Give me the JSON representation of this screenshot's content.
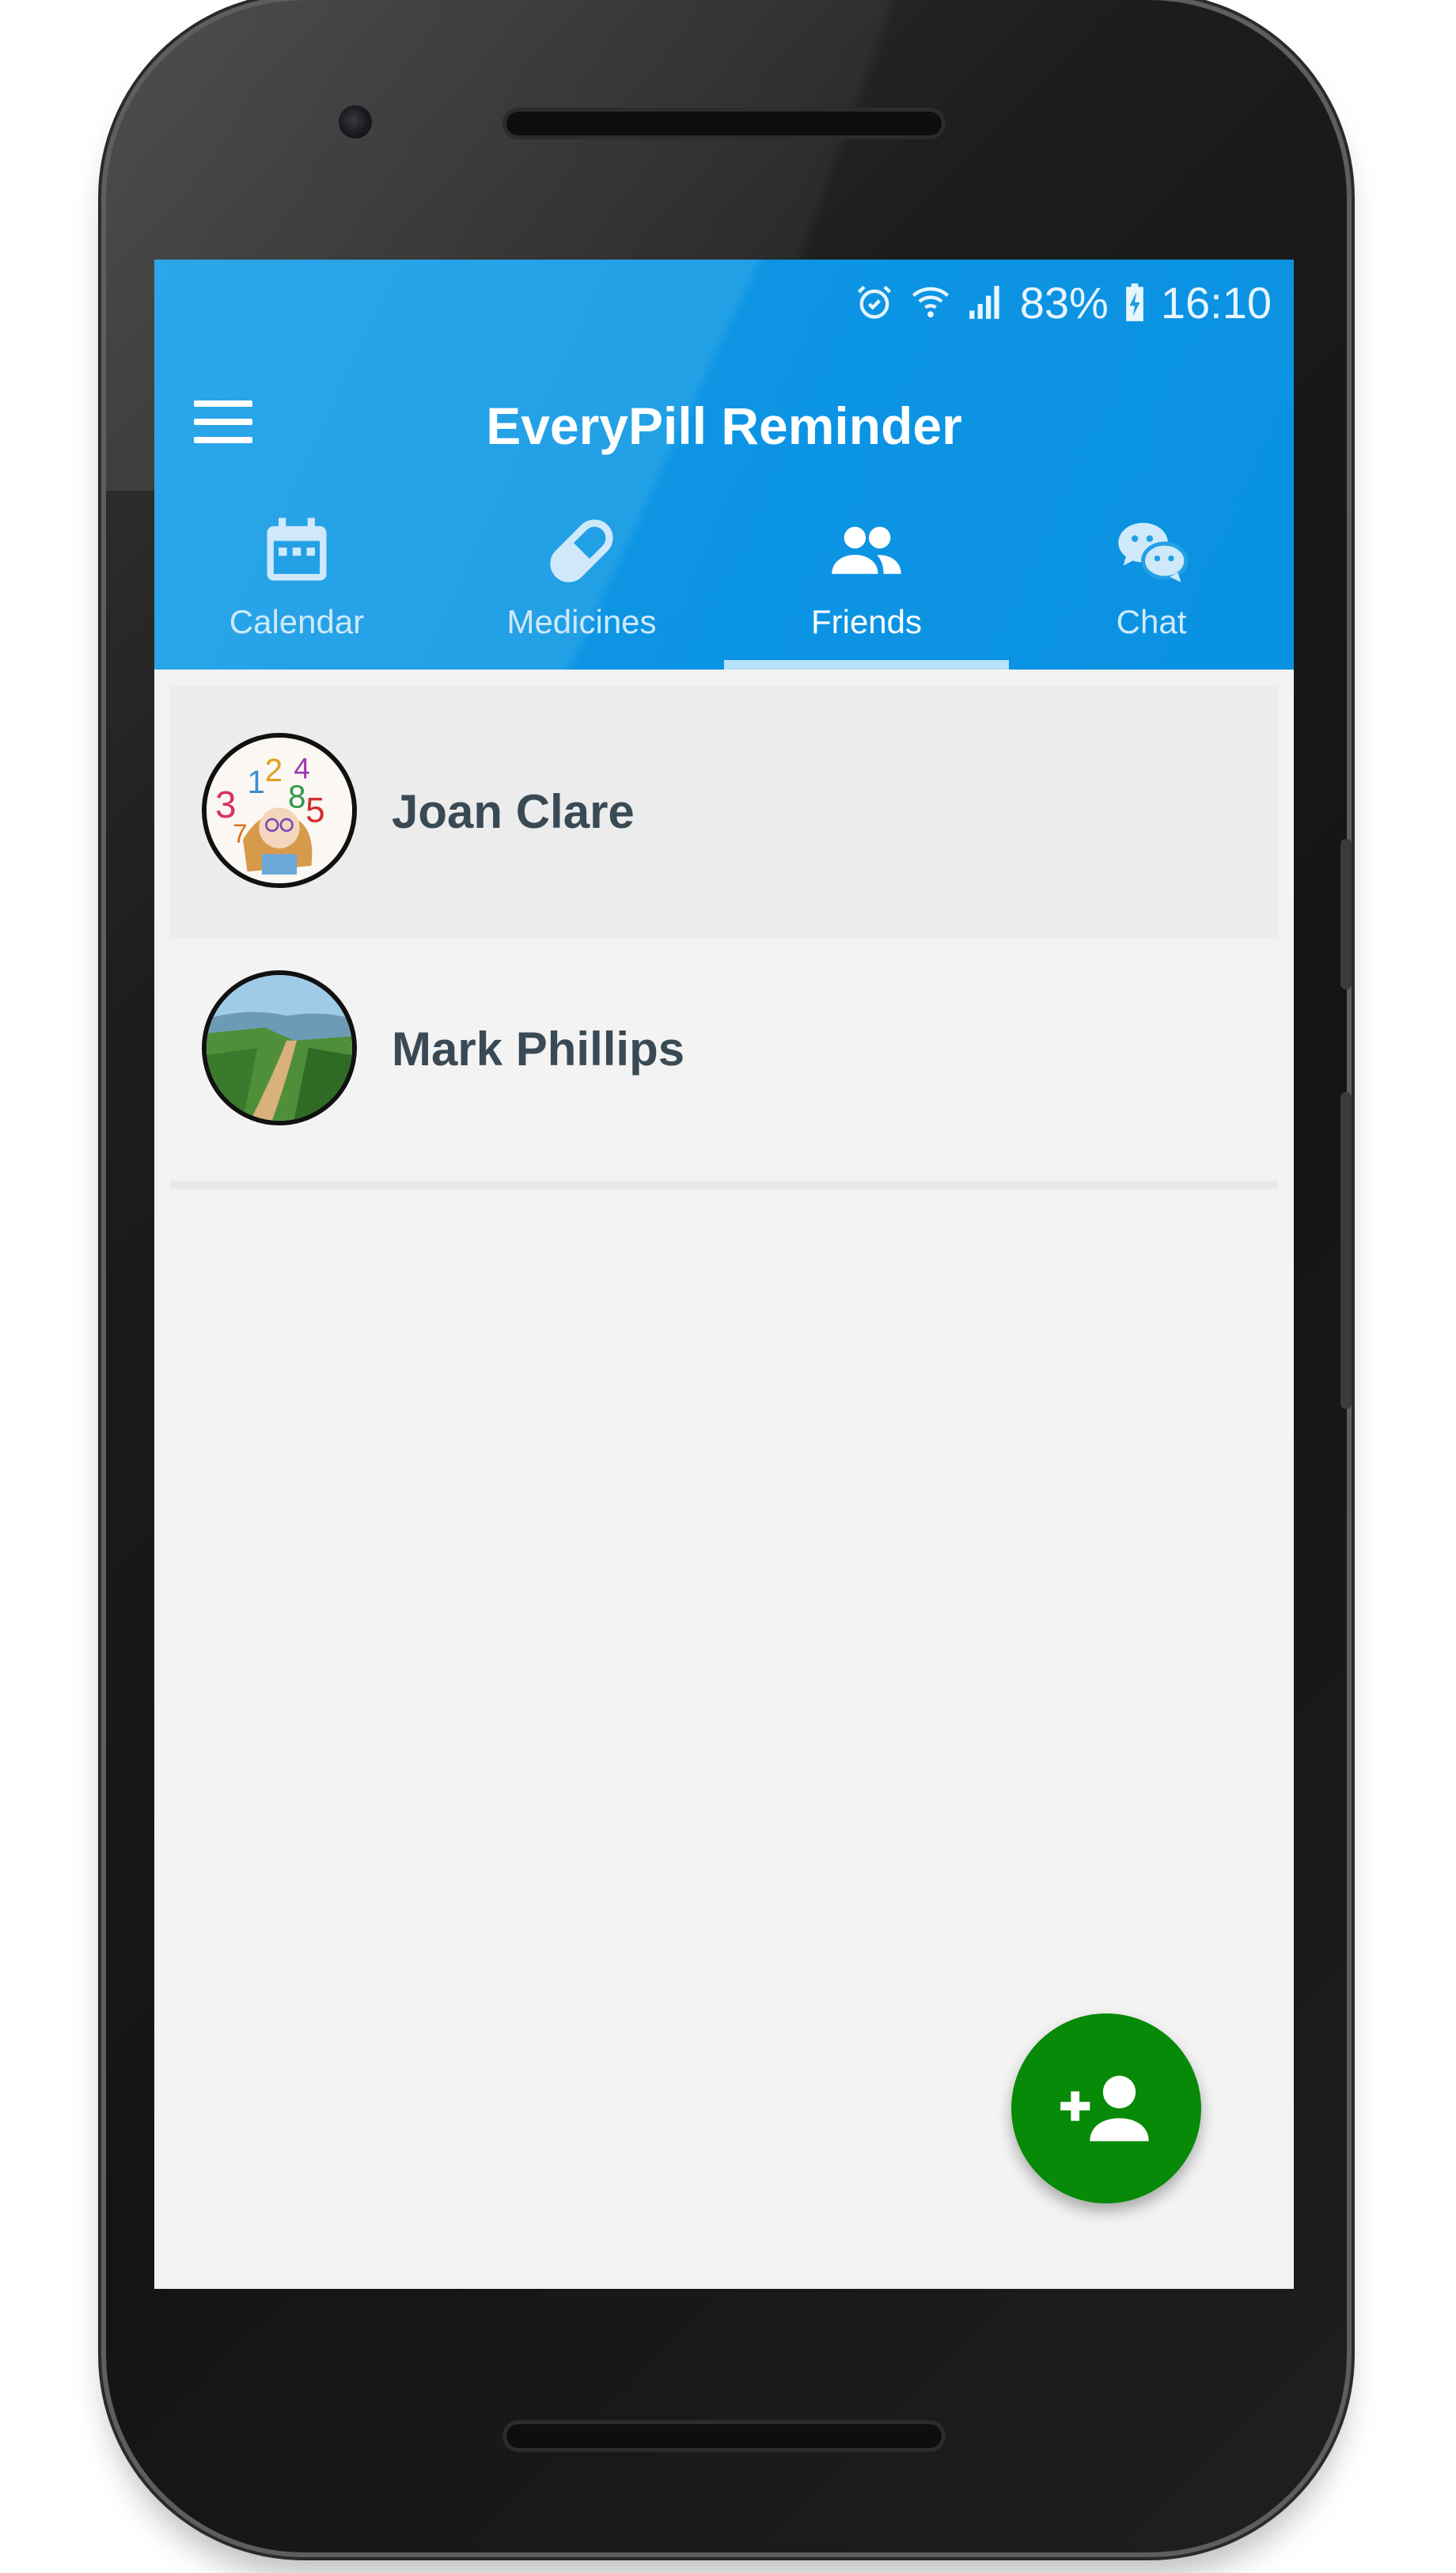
{
  "status_bar": {
    "battery": "83%",
    "time": "16:10",
    "icons": [
      "alarm-icon",
      "wifi-icon",
      "signal-icon",
      "battery-charging-icon"
    ]
  },
  "app_bar": {
    "menu_icon": "hamburger-menu-icon",
    "title": "EveryPill Reminder"
  },
  "tabs": [
    {
      "label": "Calendar",
      "icon": "calendar-icon",
      "active": false
    },
    {
      "label": "Medicines",
      "icon": "pill-icon",
      "active": false
    },
    {
      "label": "Friends",
      "icon": "people-icon",
      "active": true
    },
    {
      "label": "Chat",
      "icon": "chat-bubbles-icon",
      "active": false
    }
  ],
  "friends": [
    {
      "name": "Joan Clare",
      "avatar": "avatar-numbers-drawing",
      "selected": true
    },
    {
      "name": "Mark Phillips",
      "avatar": "avatar-landscape-path",
      "selected": false
    }
  ],
  "fab": {
    "icon": "add-person-icon"
  },
  "colors": {
    "app_bar": "#119ae4",
    "tab_inactive": "#cfe9fa",
    "tab_indicator": "#b6e2fb",
    "list_background": "#f3f3f3",
    "selected_row": "#ececec",
    "name_text": "#3a4a55",
    "fab": "#078a07"
  }
}
